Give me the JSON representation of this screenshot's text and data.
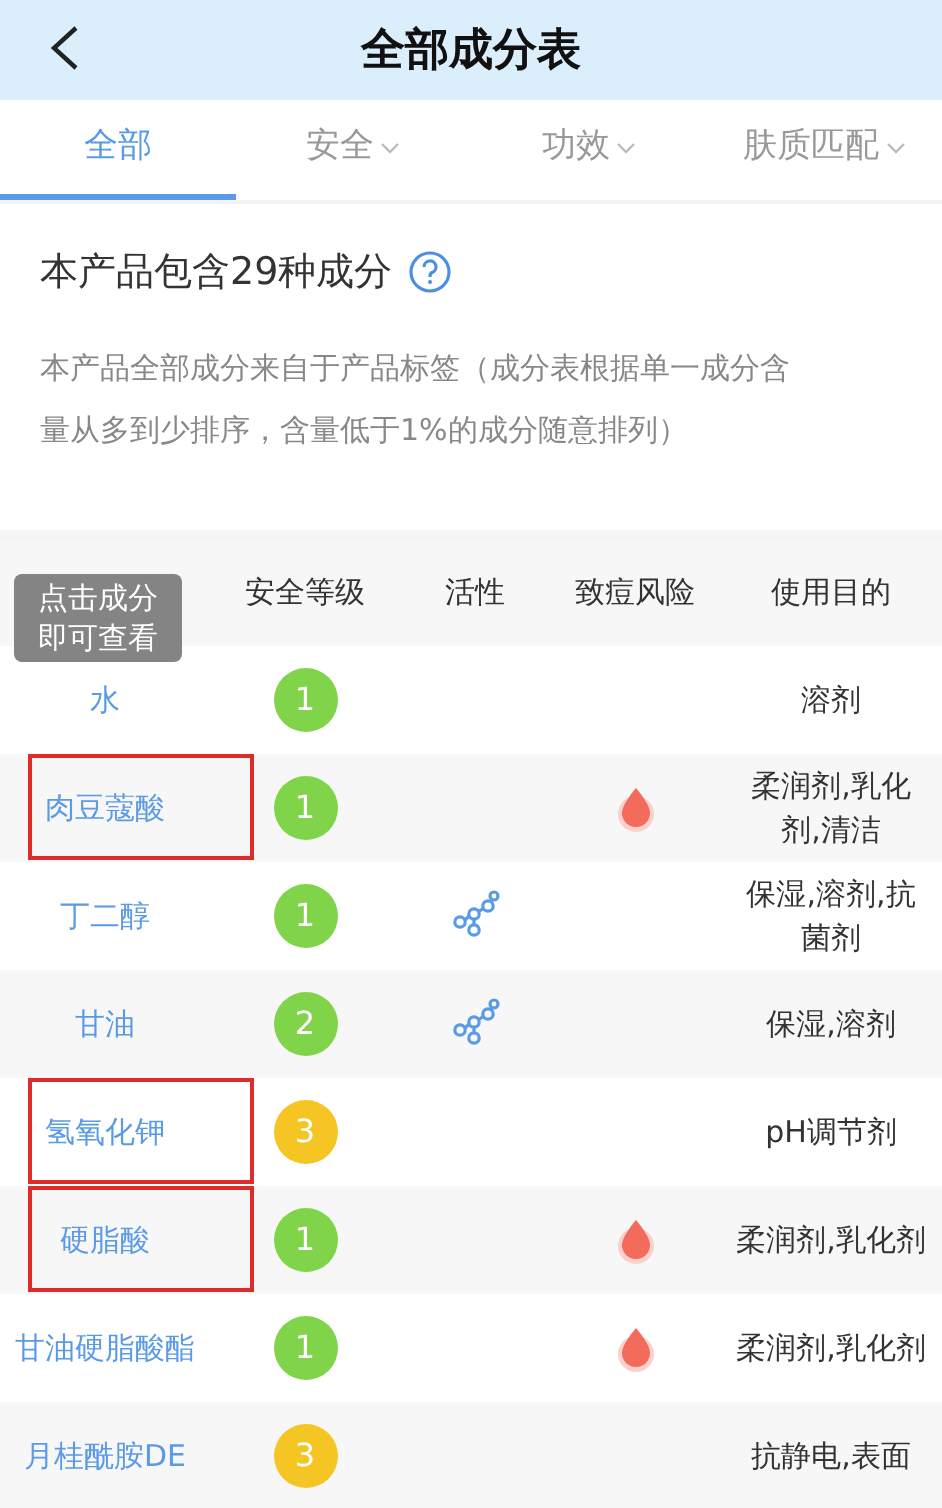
{
  "header": {
    "title": "全部成分表"
  },
  "tabs": [
    {
      "label": "全部",
      "selected": true,
      "dropdown": false
    },
    {
      "label": "安全",
      "selected": false,
      "dropdown": true
    },
    {
      "label": "功效",
      "selected": false,
      "dropdown": true
    },
    {
      "label": "肤质匹配",
      "selected": false,
      "dropdown": true
    }
  ],
  "summary": {
    "title": "本产品包含29种成分",
    "description": "本产品全部成分来自于产品标签（成分表根据单一成分含量从多到少排序，含量低于1%的成分随意排列）"
  },
  "table": {
    "columns": [
      "安全等级",
      "活性",
      "致痘风险",
      "使用目的"
    ],
    "tooltip": "点击成分即可查看",
    "rows": [
      {
        "name": "水",
        "safety": "1",
        "color": "#80d44a",
        "active": false,
        "acne_risk": false,
        "purpose": "溶剂",
        "highlighted": false
      },
      {
        "name": "肉豆蔻酸",
        "safety": "1",
        "color": "#80d44a",
        "active": false,
        "acne_risk": true,
        "purpose": "柔润剂,乳化剂,清洁",
        "highlighted": true
      },
      {
        "name": "丁二醇",
        "safety": "1",
        "color": "#80d44a",
        "active": true,
        "acne_risk": false,
        "purpose": "保湿,溶剂,抗菌剂",
        "highlighted": false
      },
      {
        "name": "甘油",
        "safety": "2",
        "color": "#80d44a",
        "active": true,
        "acne_risk": false,
        "purpose": "保湿,溶剂",
        "highlighted": false
      },
      {
        "name": "氢氧化钾",
        "safety": "3",
        "color": "#f5c623",
        "active": false,
        "acne_risk": false,
        "purpose": "pH调节剂",
        "highlighted": true
      },
      {
        "name": "硬脂酸",
        "safety": "1",
        "color": "#80d44a",
        "active": false,
        "acne_risk": true,
        "purpose": "柔润剂,乳化剂",
        "highlighted": true
      },
      {
        "name": "甘油硬脂酸酯",
        "safety": "1",
        "color": "#80d44a",
        "active": false,
        "acne_risk": true,
        "purpose": "柔润剂,乳化剂",
        "highlighted": false
      },
      {
        "name": "月桂酰胺DE",
        "safety": "3",
        "color": "#f5c623",
        "active": false,
        "acne_risk": false,
        "purpose": "抗静电,表面",
        "highlighted": false
      }
    ]
  }
}
